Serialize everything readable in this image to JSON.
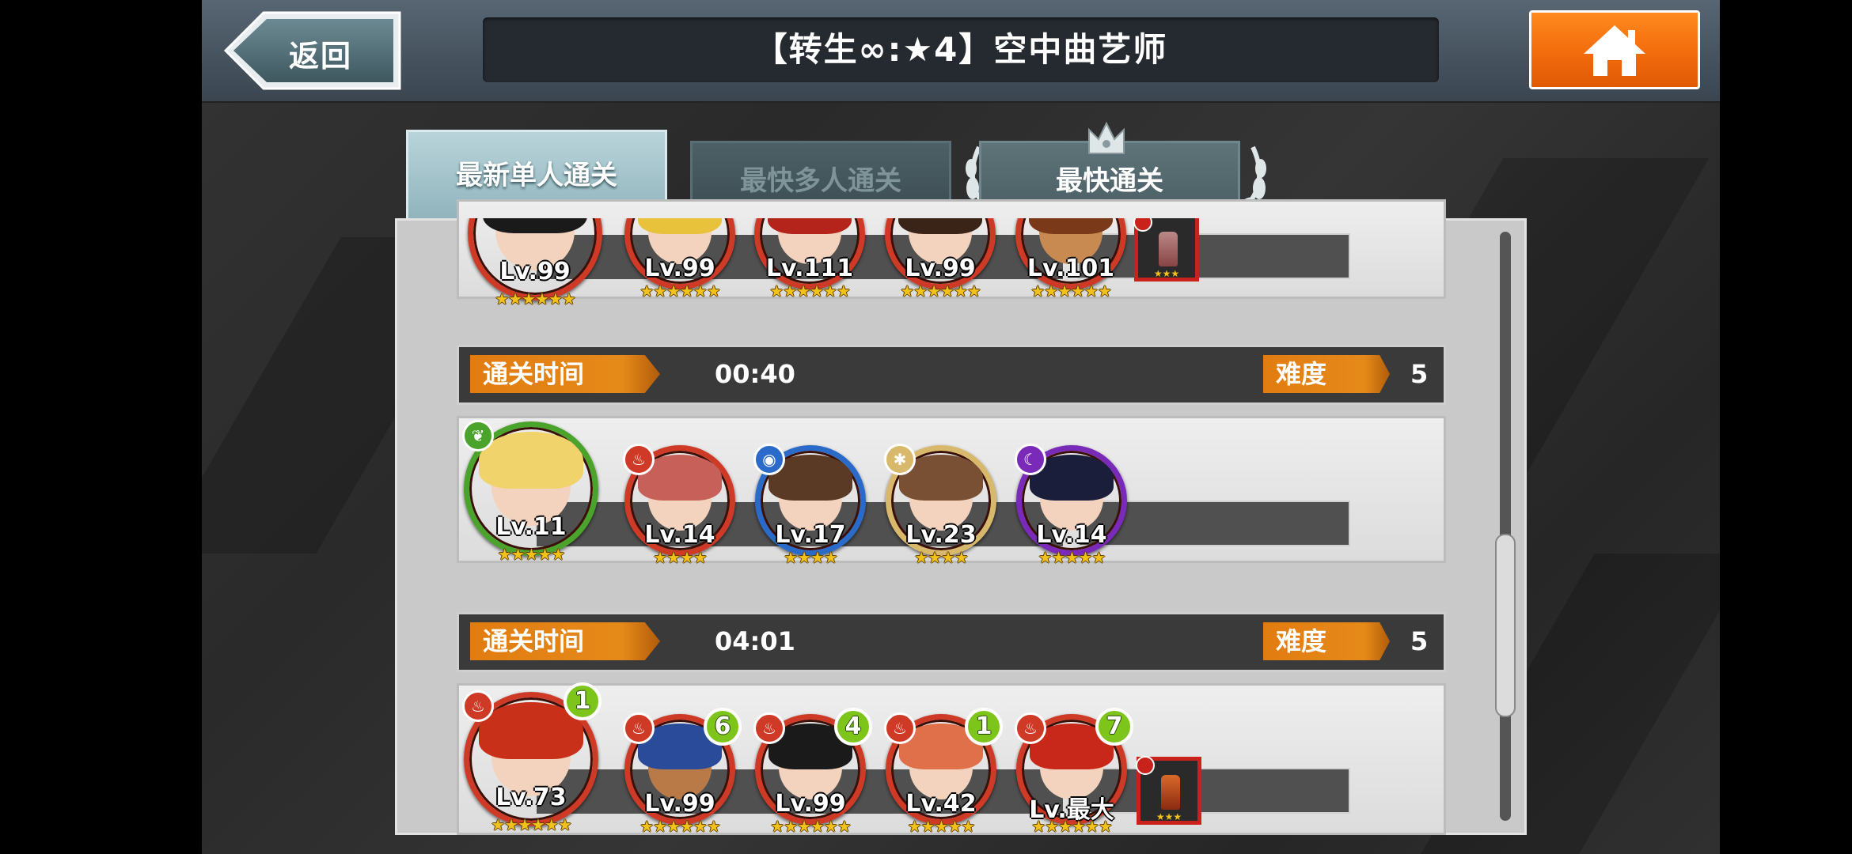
{
  "header": {
    "back_label": "返回",
    "title": "【转生∞:★4】空中曲艺师",
    "home_icon": "home-icon"
  },
  "tabs": [
    {
      "label": "最新单人通关",
      "state": "active"
    },
    {
      "label": "最快多人通关",
      "state": "inactive"
    },
    {
      "label": "最快通关",
      "state": "inactive",
      "decoration": "crown-icon"
    }
  ],
  "labels": {
    "clear_time": "通关时间",
    "difficulty": "难度"
  },
  "colors": {
    "accent_orange": "#e27c10",
    "home_orange": "#f26b0c",
    "fire_red": "#cf3a26",
    "badge_green": "#7dc51a"
  },
  "records": [
    {
      "partial": true,
      "team": [
        {
          "level": "Lv.99",
          "stars": "★★★★★★",
          "element": "fire"
        },
        {
          "level": "Lv.99",
          "stars": "★★★★★★",
          "element": "fire"
        },
        {
          "level": "Lv.111",
          "stars": "★★★★★★",
          "element": "fire"
        },
        {
          "level": "Lv.99",
          "stars": "★★★★★★",
          "element": "fire"
        },
        {
          "level": "Lv.101",
          "stars": "★★★★★★",
          "element": "fire"
        }
      ],
      "weapon": {
        "stars": "★★★"
      }
    },
    {
      "clear_time": "00:40",
      "difficulty": "5",
      "team": [
        {
          "level": "Lv.11",
          "stars": "★★★★★",
          "element": "wind"
        },
        {
          "level": "Lv.14",
          "stars": "★★★★",
          "element": "fire"
        },
        {
          "level": "Lv.17",
          "stars": "★★★★",
          "element": "water"
        },
        {
          "level": "Lv.23",
          "stars": "★★★★",
          "element": "light"
        },
        {
          "level": "Lv.14",
          "stars": "★★★★★",
          "element": "dark"
        }
      ]
    },
    {
      "clear_time": "04:01",
      "difficulty": "5",
      "team": [
        {
          "level": "Lv.73",
          "stars": "★★★★★★",
          "element": "fire",
          "badge": "1"
        },
        {
          "level": "Lv.99",
          "stars": "★★★★★★",
          "element": "fire",
          "badge": "6"
        },
        {
          "level": "Lv.99",
          "stars": "★★★★★★",
          "element": "fire",
          "badge": "4"
        },
        {
          "level": "Lv.42",
          "stars": "★★★★★",
          "element": "fire",
          "badge": "1"
        },
        {
          "level": "Lv.最大",
          "stars": "★★★★★★",
          "element": "fire",
          "badge": "7"
        }
      ],
      "weapon": {
        "stars": "★★★"
      }
    }
  ]
}
